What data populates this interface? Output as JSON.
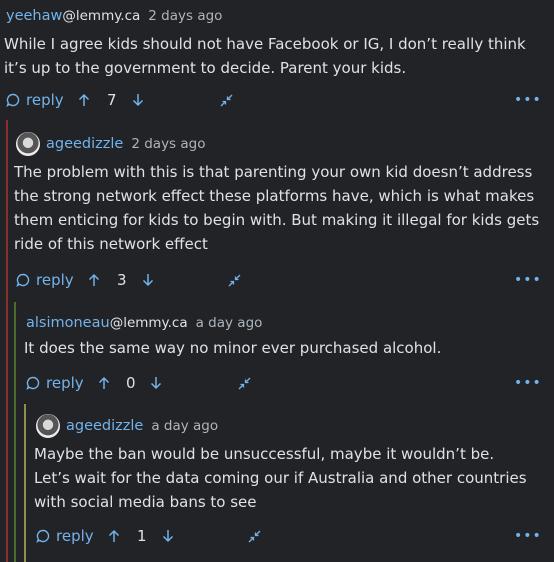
{
  "comments": [
    {
      "username": "yeehaw",
      "instance": "@lemmy.ca",
      "time": "2 days ago",
      "text": "While I agree kids should not have Facebook or IG, I don’t really think it’s up to the government to decide. Parent your kids.",
      "reply_label": "reply",
      "score": "7"
    },
    {
      "username": "ageedizzle",
      "instance": "",
      "time": "2 days ago",
      "text": "The problem with this is that parenting your own kid doesn’t address the strong network effect these platforms have, which is what makes them enticing for kids to begin with. But making it illegal for kids gets ride of this network effect",
      "reply_label": "reply",
      "score": "3"
    },
    {
      "username": "alsimoneau",
      "instance": "@lemmy.ca",
      "time": "a day ago",
      "text": "It does the same way no minor ever purchased alcohol.",
      "reply_label": "reply",
      "score": "0"
    },
    {
      "username": "ageedizzle",
      "instance": "",
      "time": "a day ago",
      "text": "Maybe the ban would be unsuccessful, maybe it wouldn’t be. Let’s wait for the data coming our if Australia and other countries with social media bans to see",
      "reply_label": "reply",
      "score": "1"
    }
  ],
  "colors": {
    "background": "#222327",
    "link": "#72b3ec",
    "text": "#dee2e6",
    "muted": "#adb5bd",
    "thread_level_1": "#e03131",
    "thread_level_2": "#5c940d",
    "thread_level_3": "#a9b64a"
  },
  "icons": [
    "reply-icon",
    "upvote-icon",
    "downvote-icon",
    "collapse-icon",
    "more-options-icon",
    "avatar"
  ]
}
